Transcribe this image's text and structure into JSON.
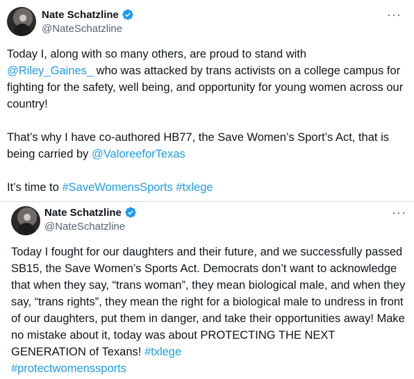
{
  "tweet1": {
    "author_name": "Nate Schatzline",
    "author_handle": "@NateSchatzline",
    "more_label": "···",
    "p1_a": "Today I, along with so many others, are proud to stand with",
    "p1_mention": "@Riley_Gaines_",
    "p1_b": " who was attacked by trans activists on a college campus for fighting for the safety, well being, and opportunity for young women across our country!",
    "p2_a": "That’s why I have co-authored HB77, the Save Women’s Sport’s Act, that is being carried by ",
    "p2_mention": "@ValoreeforTexas",
    "p3_a": "It’s time to ",
    "p3_tag1": "#SaveWomensSports",
    "p3_tag2": "#txlege"
  },
  "tweet2": {
    "author_name": "Nate Schatzline",
    "author_handle": "@NateSchatzline",
    "more_label": "···",
    "text": "Today I fought for our daughters and their future, and we successfully passed SB15, the Save Women’s Sports Act. Democrats don’t want to acknowledge that when they say, “trans woman”, they mean biological male, and when they say, “trans rights”, they mean the right for a biological male to undress  in front of our daughters, put them in danger, and take their opportunities away! Make no mistake about it, today was about PROTECTING THE NEXT GENERATION of Texans! ",
    "tag1": "#txlege",
    "tag2": "#protectwomenssports"
  },
  "icons": {
    "verified": "verified-badge-icon",
    "more": "more-options-icon"
  },
  "colors": {
    "link": "#1d9bf0",
    "text": "#0f1419",
    "secondary": "#536471",
    "divider": "#cfd9de"
  }
}
